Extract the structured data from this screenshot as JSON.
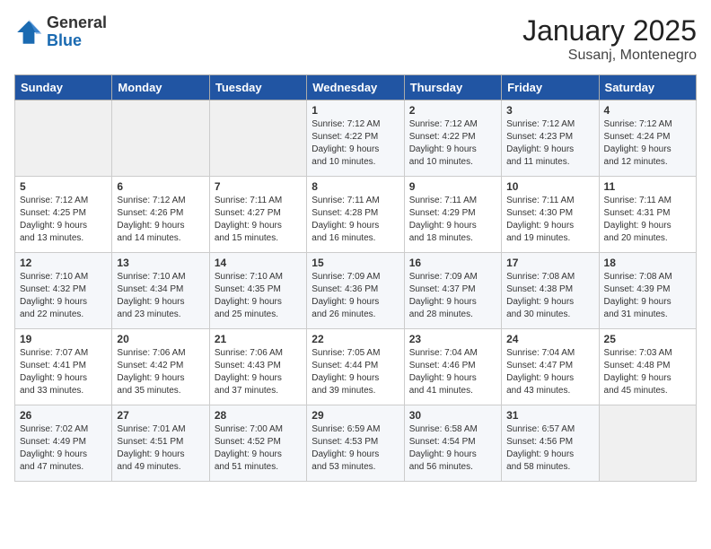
{
  "header": {
    "logo_general": "General",
    "logo_blue": "Blue",
    "month_title": "January 2025",
    "subtitle": "Susanj, Montenegro"
  },
  "weekdays": [
    "Sunday",
    "Monday",
    "Tuesday",
    "Wednesday",
    "Thursday",
    "Friday",
    "Saturday"
  ],
  "weeks": [
    [
      {
        "day": "",
        "info": ""
      },
      {
        "day": "",
        "info": ""
      },
      {
        "day": "",
        "info": ""
      },
      {
        "day": "1",
        "info": "Sunrise: 7:12 AM\nSunset: 4:22 PM\nDaylight: 9 hours\nand 10 minutes."
      },
      {
        "day": "2",
        "info": "Sunrise: 7:12 AM\nSunset: 4:22 PM\nDaylight: 9 hours\nand 10 minutes."
      },
      {
        "day": "3",
        "info": "Sunrise: 7:12 AM\nSunset: 4:23 PM\nDaylight: 9 hours\nand 11 minutes."
      },
      {
        "day": "4",
        "info": "Sunrise: 7:12 AM\nSunset: 4:24 PM\nDaylight: 9 hours\nand 12 minutes."
      }
    ],
    [
      {
        "day": "5",
        "info": "Sunrise: 7:12 AM\nSunset: 4:25 PM\nDaylight: 9 hours\nand 13 minutes."
      },
      {
        "day": "6",
        "info": "Sunrise: 7:12 AM\nSunset: 4:26 PM\nDaylight: 9 hours\nand 14 minutes."
      },
      {
        "day": "7",
        "info": "Sunrise: 7:11 AM\nSunset: 4:27 PM\nDaylight: 9 hours\nand 15 minutes."
      },
      {
        "day": "8",
        "info": "Sunrise: 7:11 AM\nSunset: 4:28 PM\nDaylight: 9 hours\nand 16 minutes."
      },
      {
        "day": "9",
        "info": "Sunrise: 7:11 AM\nSunset: 4:29 PM\nDaylight: 9 hours\nand 18 minutes."
      },
      {
        "day": "10",
        "info": "Sunrise: 7:11 AM\nSunset: 4:30 PM\nDaylight: 9 hours\nand 19 minutes."
      },
      {
        "day": "11",
        "info": "Sunrise: 7:11 AM\nSunset: 4:31 PM\nDaylight: 9 hours\nand 20 minutes."
      }
    ],
    [
      {
        "day": "12",
        "info": "Sunrise: 7:10 AM\nSunset: 4:32 PM\nDaylight: 9 hours\nand 22 minutes."
      },
      {
        "day": "13",
        "info": "Sunrise: 7:10 AM\nSunset: 4:34 PM\nDaylight: 9 hours\nand 23 minutes."
      },
      {
        "day": "14",
        "info": "Sunrise: 7:10 AM\nSunset: 4:35 PM\nDaylight: 9 hours\nand 25 minutes."
      },
      {
        "day": "15",
        "info": "Sunrise: 7:09 AM\nSunset: 4:36 PM\nDaylight: 9 hours\nand 26 minutes."
      },
      {
        "day": "16",
        "info": "Sunrise: 7:09 AM\nSunset: 4:37 PM\nDaylight: 9 hours\nand 28 minutes."
      },
      {
        "day": "17",
        "info": "Sunrise: 7:08 AM\nSunset: 4:38 PM\nDaylight: 9 hours\nand 30 minutes."
      },
      {
        "day": "18",
        "info": "Sunrise: 7:08 AM\nSunset: 4:39 PM\nDaylight: 9 hours\nand 31 minutes."
      }
    ],
    [
      {
        "day": "19",
        "info": "Sunrise: 7:07 AM\nSunset: 4:41 PM\nDaylight: 9 hours\nand 33 minutes."
      },
      {
        "day": "20",
        "info": "Sunrise: 7:06 AM\nSunset: 4:42 PM\nDaylight: 9 hours\nand 35 minutes."
      },
      {
        "day": "21",
        "info": "Sunrise: 7:06 AM\nSunset: 4:43 PM\nDaylight: 9 hours\nand 37 minutes."
      },
      {
        "day": "22",
        "info": "Sunrise: 7:05 AM\nSunset: 4:44 PM\nDaylight: 9 hours\nand 39 minutes."
      },
      {
        "day": "23",
        "info": "Sunrise: 7:04 AM\nSunset: 4:46 PM\nDaylight: 9 hours\nand 41 minutes."
      },
      {
        "day": "24",
        "info": "Sunrise: 7:04 AM\nSunset: 4:47 PM\nDaylight: 9 hours\nand 43 minutes."
      },
      {
        "day": "25",
        "info": "Sunrise: 7:03 AM\nSunset: 4:48 PM\nDaylight: 9 hours\nand 45 minutes."
      }
    ],
    [
      {
        "day": "26",
        "info": "Sunrise: 7:02 AM\nSunset: 4:49 PM\nDaylight: 9 hours\nand 47 minutes."
      },
      {
        "day": "27",
        "info": "Sunrise: 7:01 AM\nSunset: 4:51 PM\nDaylight: 9 hours\nand 49 minutes."
      },
      {
        "day": "28",
        "info": "Sunrise: 7:00 AM\nSunset: 4:52 PM\nDaylight: 9 hours\nand 51 minutes."
      },
      {
        "day": "29",
        "info": "Sunrise: 6:59 AM\nSunset: 4:53 PM\nDaylight: 9 hours\nand 53 minutes."
      },
      {
        "day": "30",
        "info": "Sunrise: 6:58 AM\nSunset: 4:54 PM\nDaylight: 9 hours\nand 56 minutes."
      },
      {
        "day": "31",
        "info": "Sunrise: 6:57 AM\nSunset: 4:56 PM\nDaylight: 9 hours\nand 58 minutes."
      },
      {
        "day": "",
        "info": ""
      }
    ]
  ]
}
